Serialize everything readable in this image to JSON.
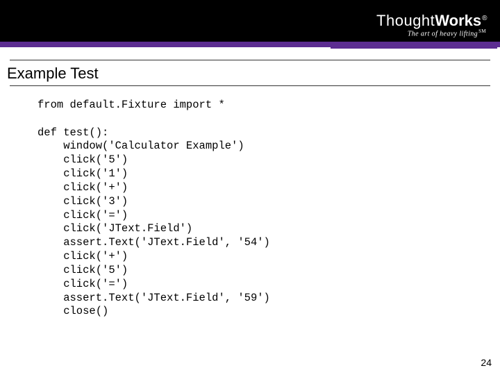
{
  "header": {
    "brand_prefix": "Thought",
    "brand_suffix": "Works",
    "registered": "®",
    "tagline": "The art of heavy lifting",
    "sm": "SM"
  },
  "title": "Example Test",
  "code": {
    "line01": "from default.Fixture import *",
    "blank1": "",
    "line02": "def test():",
    "line03": "    window('Calculator Example')",
    "line04": "    click('5')",
    "line05": "    click('1')",
    "line06": "    click('+')",
    "line07": "    click('3')",
    "line08": "    click('=')",
    "line09": "    click('JText.Field')",
    "line10": "    assert.Text('JText.Field', '54')",
    "line11": "    click('+')",
    "line12": "    click('5')",
    "line13": "    click('=')",
    "line14": "    assert.Text('JText.Field', '59')",
    "line15": "    close()"
  },
  "page_number": "24"
}
